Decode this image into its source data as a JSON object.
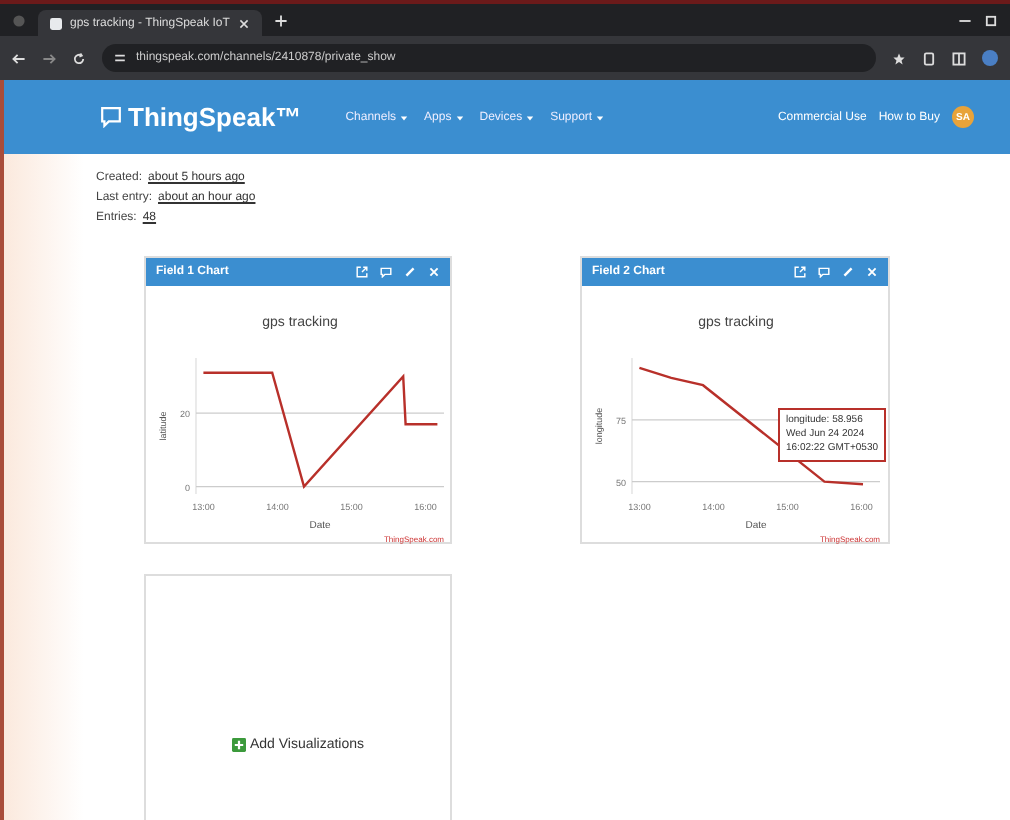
{
  "browser": {
    "tab_title": "gps tracking - ThingSpeak IoT",
    "url": "thingspeak.com/channels/2410878/private_show"
  },
  "nav": {
    "logo": "ThingSpeak™",
    "menus": [
      "Channels",
      "Apps",
      "Devices",
      "Support"
    ],
    "links": [
      "Commercial Use",
      "How to Buy"
    ],
    "avatar": "SA"
  },
  "info": [
    {
      "label": "Created:",
      "value": "about 5 hours ago"
    },
    {
      "label": "Last entry:",
      "value": "about an hour ago"
    },
    {
      "label": "Entries:",
      "value": "48"
    }
  ],
  "cards": [
    {
      "kind": "chart",
      "title": "Field 1 Chart",
      "credit": "ThingSpeak.com",
      "chart_data": {
        "type": "line",
        "title": "gps tracking",
        "xlabel": "Date",
        "ylabel": "latitude",
        "x": [
          13.0,
          13.93,
          14.36,
          15.7,
          15.73,
          16.16
        ],
        "series": [
          {
            "color": "#b8302a",
            "values": [
              31,
              31,
              0,
              30,
              17,
              17
            ]
          }
        ],
        "xlim": [
          12.9,
          16.25
        ],
        "ylim": [
          -2,
          35
        ],
        "xticks": [
          {
            "value": 13,
            "label": "13:00"
          },
          {
            "value": 14,
            "label": "14:00"
          },
          {
            "value": 15,
            "label": "15:00"
          },
          {
            "value": 16,
            "label": "16:00"
          }
        ],
        "yticks": [
          0,
          20
        ]
      }
    },
    {
      "kind": "chart",
      "title": "Field 2 Chart",
      "credit": "ThingSpeak.com",
      "tooltip": [
        "longitude: 58.956",
        "Wed Jun 24 2024",
        "16:02:22 GMT+0530"
      ],
      "chart_data": {
        "type": "line",
        "title": "gps tracking",
        "xlabel": "Date",
        "ylabel": "longitude",
        "x": [
          13.0,
          13.43,
          13.86,
          15.5,
          16.02
        ],
        "series": [
          {
            "color": "#b8302a",
            "values": [
              96,
              92,
              89,
              50,
              49
            ]
          }
        ],
        "xlim": [
          12.9,
          16.25
        ],
        "ylim": [
          45,
          100
        ],
        "xticks": [
          {
            "value": 13,
            "label": "13:00"
          },
          {
            "value": 14,
            "label": "14:00"
          },
          {
            "value": 15,
            "label": "15:00"
          },
          {
            "value": 16,
            "label": "16:00"
          }
        ],
        "yticks": [
          50,
          75
        ]
      }
    },
    {
      "kind": "add",
      "label": "Add Visualizations"
    }
  ]
}
